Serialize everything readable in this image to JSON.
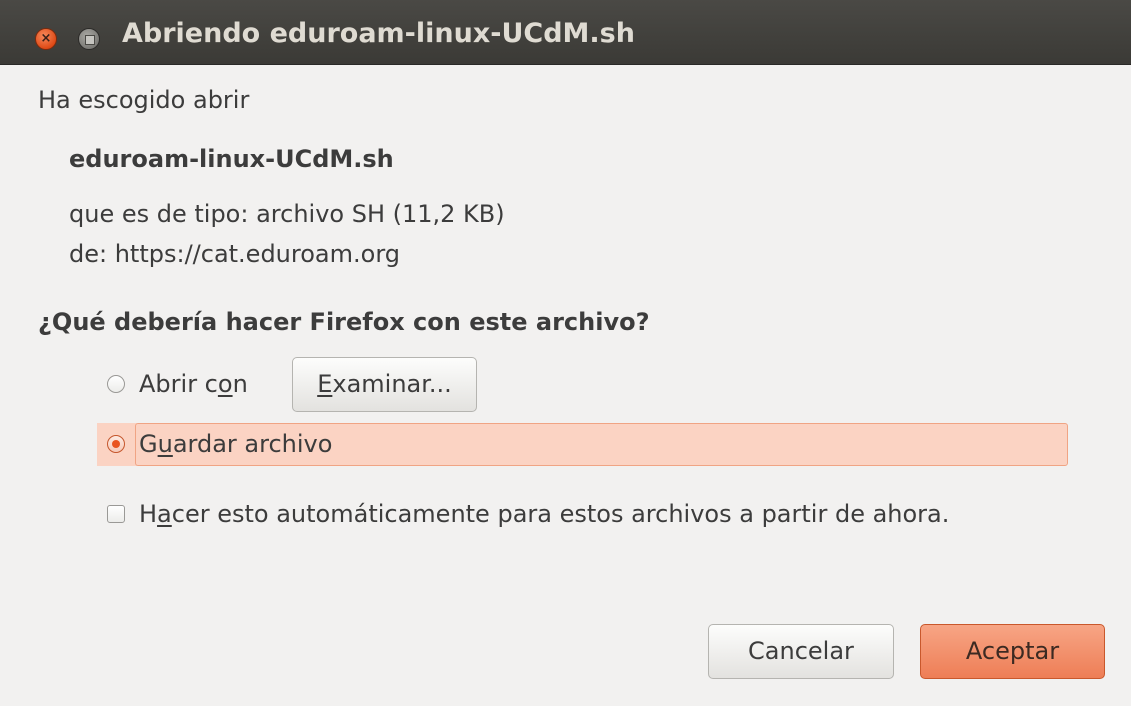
{
  "window": {
    "title": "Abriendo eduroam-linux-UCdM.sh"
  },
  "dialog": {
    "intro": "Ha escogido abrir",
    "filename": "eduroam-linux-UCdM.sh",
    "type_line": "que es de tipo:  archivo SH (11,2 KB)",
    "from_line": "de:  https://cat.eduroam.org",
    "question": "¿Qué debería hacer Firefox con este archivo?",
    "open_with": {
      "label_before": "Abrir c",
      "mnemonic": "o",
      "label_after": "n",
      "checked": false
    },
    "browse_button": {
      "mnemonic": "E",
      "label_after": "xaminar..."
    },
    "save_file": {
      "label_before": "G",
      "mnemonic": "u",
      "label_after": "ardar archivo",
      "checked": true
    },
    "auto_checkbox": {
      "label_before": "H",
      "mnemonic": "a",
      "label_after": "cer esto automáticamente para estos archivos a partir de ahora.",
      "checked": false
    },
    "cancel_label": "Cancelar",
    "accept_label": "Aceptar"
  },
  "colors": {
    "accent": "#e95420",
    "titlebar": "#3c3b37",
    "background": "#f2f1f0"
  }
}
